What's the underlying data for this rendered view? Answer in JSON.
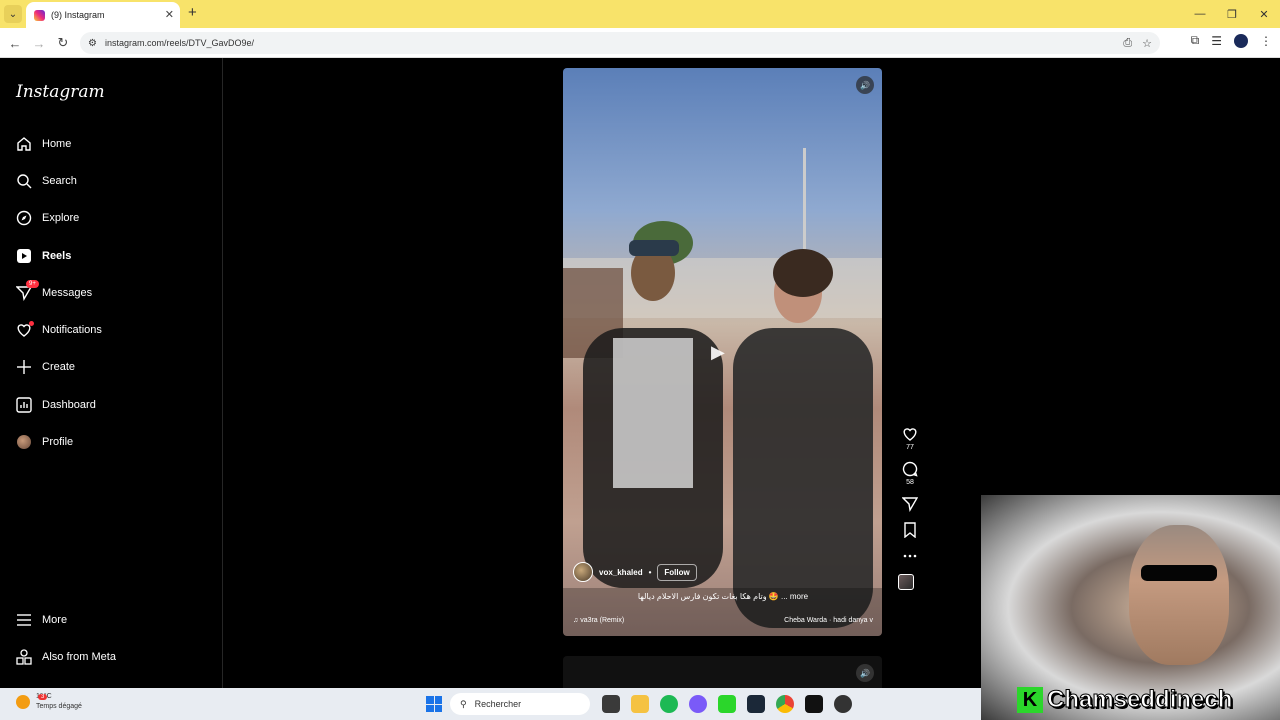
{
  "browser": {
    "tab_title": "(9) Instagram",
    "url": "instagram.com/reels/DTV_GavDO9e/"
  },
  "sidebar": {
    "logo": "Instagram",
    "items": [
      {
        "label": "Home",
        "icon": "home-icon"
      },
      {
        "label": "Search",
        "icon": "search-icon"
      },
      {
        "label": "Explore",
        "icon": "compass-icon"
      },
      {
        "label": "Reels",
        "icon": "reels-icon"
      },
      {
        "label": "Messages",
        "icon": "messenger-icon",
        "badge": "9+"
      },
      {
        "label": "Notifications",
        "icon": "heart-icon"
      },
      {
        "label": "Create",
        "icon": "plus-icon"
      },
      {
        "label": "Dashboard",
        "icon": "chart-icon"
      },
      {
        "label": "Profile",
        "icon": "avatar"
      }
    ],
    "more": "More",
    "meta": "Also from Meta"
  },
  "reel": {
    "author": "vox_khaled",
    "separator": "•",
    "follow": "Follow",
    "caption": "وتام هكا بغات تكون فارس الاحلام ديالها 🤩 ... more",
    "audio_original": "♫ va3ra (Remix)",
    "audio_track": "Cheba Warda · hadi danya v",
    "likes": "77",
    "comments": "58"
  },
  "webcam": {
    "name": "Chamseddinech",
    "logo": "K"
  },
  "taskbar": {
    "temp": "12°C",
    "weather": "Temps dégagé",
    "weather_badge": "3",
    "search_placeholder": "Rechercher"
  }
}
